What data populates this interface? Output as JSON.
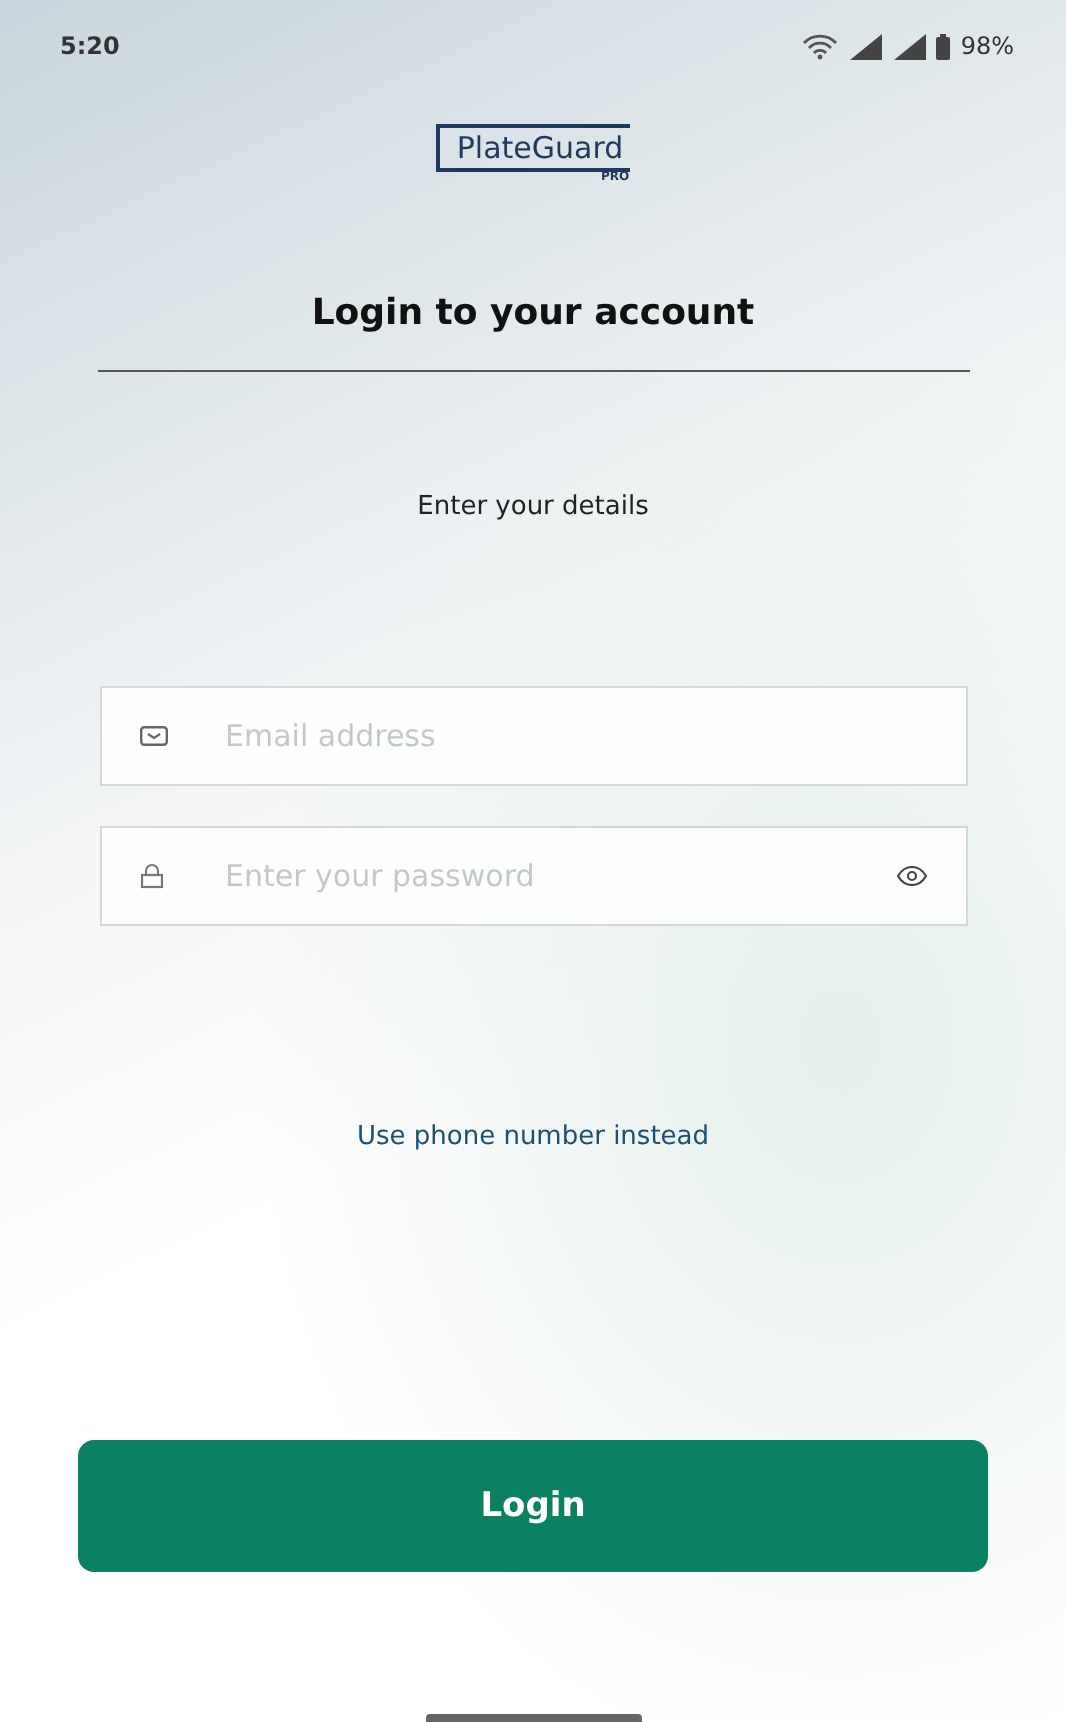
{
  "status_bar": {
    "time": "5:20",
    "battery": "98%"
  },
  "logo": {
    "name": "PlateGuard",
    "tag": "PRO"
  },
  "title": "Login to your account",
  "subtitle": "Enter your details",
  "fields": [
    {
      "kind": "email",
      "placeholder": "Email address"
    },
    {
      "kind": "password",
      "placeholder": "Enter your password"
    }
  ],
  "alt_link": "Use phone number instead",
  "login_button": "Login"
}
